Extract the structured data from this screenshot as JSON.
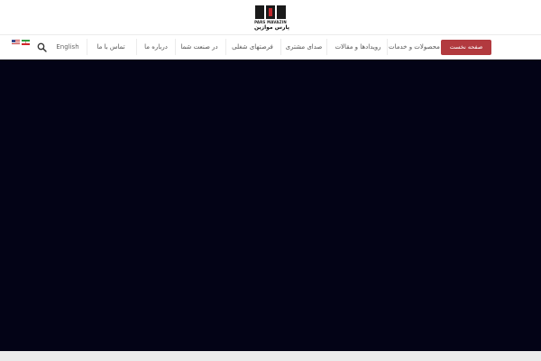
{
  "brand": {
    "name_en": "PARS MAVAZIN",
    "name_fa": "پارس موازین",
    "colors": {
      "dark": "#1a1a1a",
      "accent_red": "#b23a3f",
      "hero_bg": "#030316"
    }
  },
  "header": {
    "logo_icon": "pars-mavazin-logo"
  },
  "nav": {
    "cta_label": "صفحه نخست",
    "items": [
      {
        "label": "محصولات و خدمات"
      },
      {
        "label": "رویدادها و مقالات"
      },
      {
        "label": "صدای مشتری"
      },
      {
        "label": "فرصتهای شغلی"
      },
      {
        "label": "در صنعت شما"
      },
      {
        "label": "درباره ما"
      },
      {
        "label": "تماس با ما"
      }
    ],
    "language_label": "English",
    "search_icon": "search-icon",
    "flags": [
      "us-flag-icon",
      "iran-flag-icon"
    ]
  }
}
